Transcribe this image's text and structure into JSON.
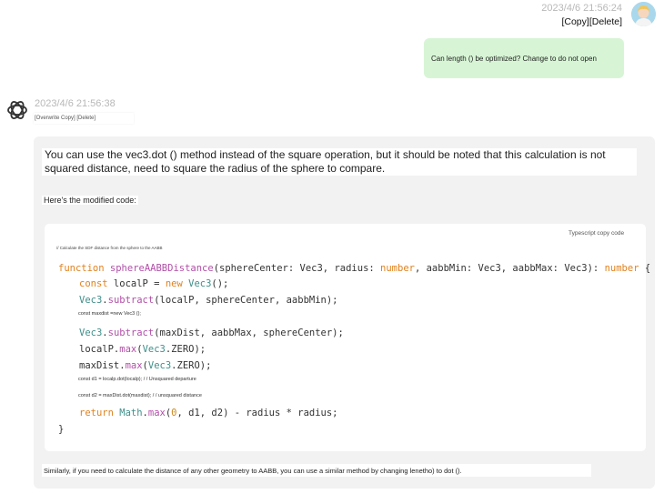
{
  "user": {
    "timestamp": "2023/4/6 21:56:24",
    "copy_label": "[Copy]",
    "delete_label": "[Delete]",
    "message": "Can length () be optimized? Change to do not open"
  },
  "bot": {
    "timestamp": "2023/4/6 21:56:38",
    "actions_label": "[Overwrite Copy] [Delete]",
    "paragraph1": "You can use the vec3.dot () method instead of the square operation, but it should be noted that this calculation is not squared distance, need to square the radius of the sphere to compare.",
    "paragraph2": "Here's the modified code:",
    "code": {
      "actions_label": "Typescript copy code",
      "comment": "// Calculate the SDF distance from the sphere to the AABB",
      "l1_kw": "function",
      "l1_fn": "sphereAABBDistance",
      "l1_a": "(sphereCenter: Vec3, radius: ",
      "l1_t1": "number",
      "l1_b": ", aabbMin: Vec3, aabbMax: Vec3): ",
      "l1_t2": "number",
      "l1_c": " {",
      "l2_kw": "const",
      "l2_a": " localP = ",
      "l2_kw2": "new",
      "l2_cl": " Vec3",
      "l2_b": "();",
      "l3_cl": "Vec3",
      "l3_a": ".",
      "l3_fn": "subtract",
      "l3_b": "(localP, sphereCenter, aabbMin);",
      "s1": "const maxdist =new Vec3 ();",
      "l5_cl": "Vec3",
      "l5_a": ".",
      "l5_fn": "subtract",
      "l5_b": "(maxDist, aabbMax, sphereCenter);",
      "l6_a": "localP.",
      "l6_fn": "max",
      "l6_b": "(",
      "l6_cl": "Vec3",
      "l6_c": ".ZERO);",
      "l7_a": "maxDist.",
      "l7_fn": "max",
      "l7_b": "(",
      "l7_cl": "Vec3",
      "l7_c": ".ZERO);",
      "s2": "const d1 = localp.dot(localp); / / Unsquared departure",
      "s3": "const d2 = maxDist.dot(maxdist); / / unsquared distance",
      "l10_kw": "return",
      "l10_cl": " Math",
      "l10_a": ".",
      "l10_fn": "max",
      "l10_b": "(",
      "l10_num": "0",
      "l10_c": ", d1, d2) - radius * radius;",
      "l11": "}"
    },
    "paragraph3": "Similarly, if you need to calculate the distance of any other geometry to AABB, you can use a similar method by changing lenetho) to dot ()."
  }
}
